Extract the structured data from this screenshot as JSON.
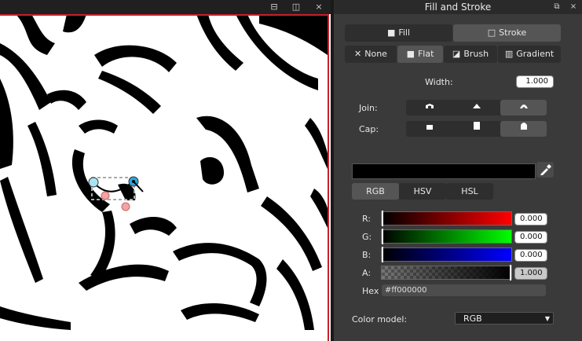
{
  "canvas_window": {
    "buttons": [
      {
        "name": "dock-left-icon",
        "glyph": "⊟"
      },
      {
        "name": "split-icon",
        "glyph": "◫"
      },
      {
        "name": "close-icon",
        "glyph": "×"
      }
    ]
  },
  "panel": {
    "title": "Fill and Stroke",
    "title_buttons": [
      {
        "name": "float-icon",
        "glyph": "⧉"
      },
      {
        "name": "close-icon",
        "glyph": "×"
      }
    ],
    "tabs": [
      {
        "label": "Fill",
        "glyph": "■",
        "active": false
      },
      {
        "label": "Stroke",
        "glyph": "□",
        "active": true
      }
    ],
    "paint_types": [
      {
        "label": "None",
        "glyph": "✕",
        "active": false
      },
      {
        "label": "Flat",
        "glyph": "■",
        "active": true
      },
      {
        "label": "Brush",
        "glyph": "◪",
        "active": false
      },
      {
        "label": "Gradient",
        "glyph": "▥",
        "active": false
      }
    ],
    "width_label": "Width:",
    "width_value": "1.000",
    "join_label": "Join:",
    "join_options": [
      "miter",
      "bevel",
      "round"
    ],
    "join_selected": "round",
    "cap_label": "Cap:",
    "cap_options": [
      "butt",
      "square",
      "round"
    ],
    "cap_selected": "round",
    "stroke_color": "#000000",
    "color_tabs": [
      {
        "label": "RGB",
        "active": true
      },
      {
        "label": "HSV",
        "active": false
      },
      {
        "label": "HSL",
        "active": false
      }
    ],
    "channels": [
      {
        "label": "R:",
        "value": "0.000",
        "level": 0.0,
        "color": "#ff0000"
      },
      {
        "label": "G:",
        "value": "0.000",
        "level": 0.0,
        "color": "#00ff00"
      },
      {
        "label": "B:",
        "value": "0.000",
        "level": 0.0,
        "color": "#0000ff"
      },
      {
        "label": "A:",
        "value": "1.000",
        "level": 1.0,
        "color": "alpha"
      }
    ],
    "hex_label": "Hex",
    "hex_value": "#ff000000",
    "color_model_label": "Color model:",
    "color_model_value": "RGB"
  }
}
